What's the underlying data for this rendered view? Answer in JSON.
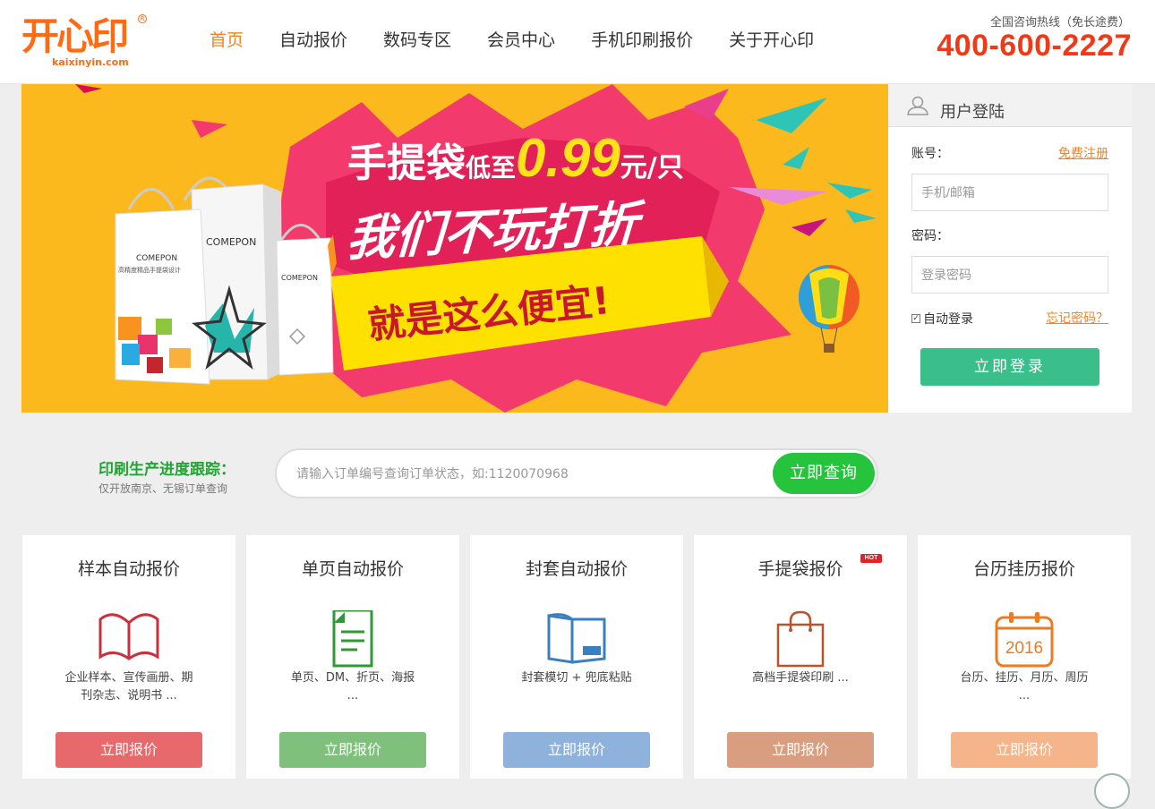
{
  "header": {
    "logo_text": "开心印",
    "logo_domain": "kaixinyin.com",
    "nav": [
      {
        "label": "首页",
        "active": true
      },
      {
        "label": "自动报价"
      },
      {
        "label": "数码专区"
      },
      {
        "label": "会员中心"
      },
      {
        "label": "手机印刷报价"
      },
      {
        "label": "关于开心印"
      }
    ],
    "hotline_label": "全国咨询热线（免长途费）",
    "hotline_number": "400-600-2227"
  },
  "banner": {
    "title_main": "手提袋",
    "title_low": "低至",
    "title_price": "0.99",
    "title_unit": "元/只",
    "slogan": "我们不玩打折",
    "tagline": "就是这么便宜!",
    "bag_brand": "COMEPON",
    "bag_caption": "高精度精品手提袋设计"
  },
  "login": {
    "title": "用户登陆",
    "account_label": "账号：",
    "register_link": "免费注册",
    "account_placeholder": "手机/邮箱",
    "password_label": "密码：",
    "password_placeholder": "登录密码",
    "remember_label": "自动登录",
    "remember_checked": true,
    "forgot_link": "忘记密码？",
    "submit": "立即登录"
  },
  "track": {
    "title": "印刷生产进度跟踪：",
    "subtitle": "仅开放南京、无锡订单查询",
    "placeholder": "请输入订单编号查询订单状态，如:1120070968",
    "button": "立即查询"
  },
  "cards": [
    {
      "title": "样本自动报价",
      "desc": "企业样本、宣传画册、期刊杂志、说明书 ...",
      "button": "立即报价",
      "icon": "open-book-icon",
      "color": "#e8696b"
    },
    {
      "title": "单页自动报价",
      "desc": "单页、DM、折页、海报 ...",
      "button": "立即报价",
      "icon": "document-icon",
      "color": "#7ec07c"
    },
    {
      "title": "封套自动报价",
      "desc": "封套模切 + 兜底粘贴",
      "button": "立即报价",
      "icon": "folder-cover-icon",
      "color": "#8fb2dc"
    },
    {
      "title": "手提袋报价",
      "desc": "高档手提袋印刷 ...",
      "button": "立即报价",
      "icon": "shopping-bag-icon",
      "color": "#d99e7f",
      "badge": "HOT"
    },
    {
      "title": "台历挂历报价",
      "desc": "台历、挂历、月历、周历 ...",
      "button": "立即报价",
      "icon": "calendar-icon",
      "color": "#f5b48a",
      "icon_text": "2016"
    }
  ],
  "colors": {
    "accent": "#f7821f",
    "hotline": "#f03a17",
    "login_button": "#3bbf8a",
    "track_button": "#26c43d",
    "track_title": "#20a432"
  }
}
